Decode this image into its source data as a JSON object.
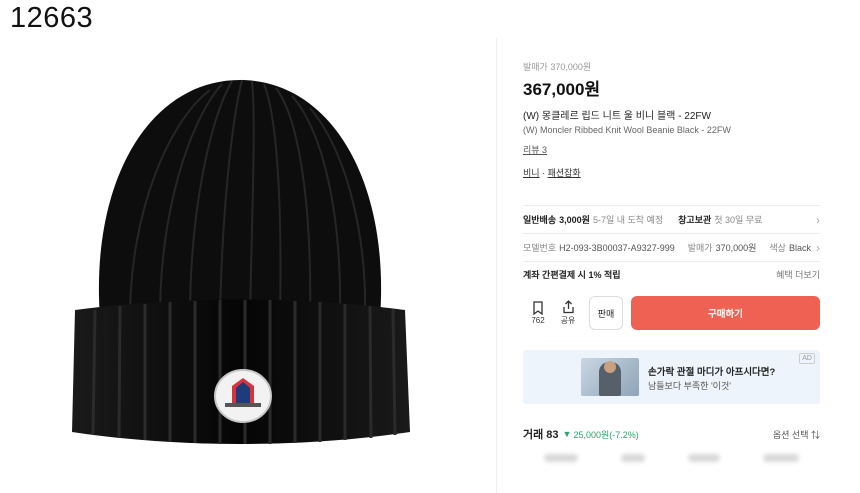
{
  "overlay_id": "12663",
  "product": {
    "release_price_label": "발매가 370,000원",
    "price": "367,000원",
    "title_ko": "(W) 몽클레르 립드 니트 울 비니 블랙 - 22FW",
    "title_en": "(W) Moncler Ribbed Knit Wool Beanie Black - 22FW",
    "review": "리뷰 3",
    "category_1": "비니",
    "category_sep": " · ",
    "category_2": "패션잡화"
  },
  "shipping": {
    "label": "일반배송",
    "price": "3,000원",
    "eta": "5-7일 내 도착 예정",
    "warehouse_label": "창고보관",
    "warehouse_value": "첫 30일 무료"
  },
  "details": {
    "model_label": "모델번호",
    "model_value": "H2-093-3B00037-A9327-999",
    "release_label": "발매가",
    "release_value": "370,000원",
    "color_label": "색상",
    "color_value": "Black"
  },
  "benefit": {
    "text": "계좌 간편결제 시 1% 적립",
    "more": "혜택 더보기"
  },
  "actions": {
    "bookmark_count": "762",
    "share_label": "공유",
    "sell_label": "판매",
    "buy_label": "구매하기"
  },
  "ad": {
    "headline": "손가락 관절 마디가 아프시다면?",
    "subline": "남들보다 부족한 '이것'",
    "tag": "AD"
  },
  "trades": {
    "label": "거래 83",
    "change": "25,000원(-7.2%)",
    "option_sort": "옵션 선택 ⇅"
  },
  "colors": {
    "buy_button": "#ef6253",
    "price_down": "#2fa36b",
    "ad_bg": "#eef4fb"
  }
}
